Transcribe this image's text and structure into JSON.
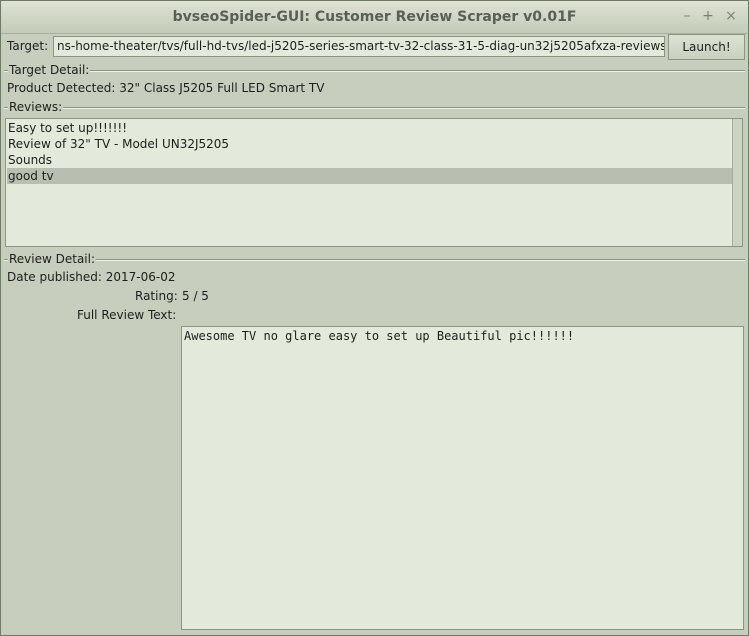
{
  "window": {
    "title": "bvseoSpider-GUI: Customer Review Scraper v0.01F",
    "controls": {
      "minimize": "–",
      "maximize": "+",
      "close": "×"
    }
  },
  "target": {
    "label": "Target:",
    "value": "ns-home-theater/tvs/full-hd-tvs/led-j5205-series-smart-tv-32-class-31-5-diag-un32j5205afxza-reviews",
    "launch_label": "Launch!"
  },
  "target_detail": {
    "group_label": "Target Detail:",
    "product_detected": "Product Detected: 32\" Class J5205 Full LED Smart TV"
  },
  "reviews": {
    "group_label": "Reviews:",
    "items": [
      {
        "label": "Easy to set up!!!!!!!",
        "selected": false
      },
      {
        "label": "Review of 32\" TV - Model UN32J5205",
        "selected": false
      },
      {
        "label": "Sounds",
        "selected": false
      },
      {
        "label": "good tv",
        "selected": true
      }
    ]
  },
  "review_detail": {
    "group_label": "Review Detail:",
    "date_published": "Date published: 2017-06-02",
    "rating_label": "Rating:",
    "rating_value": "5 / 5",
    "full_text_label": "Full Review Text:",
    "full_text": "Awesome TV no glare easy to set up Beautiful pic!!!!!!"
  }
}
